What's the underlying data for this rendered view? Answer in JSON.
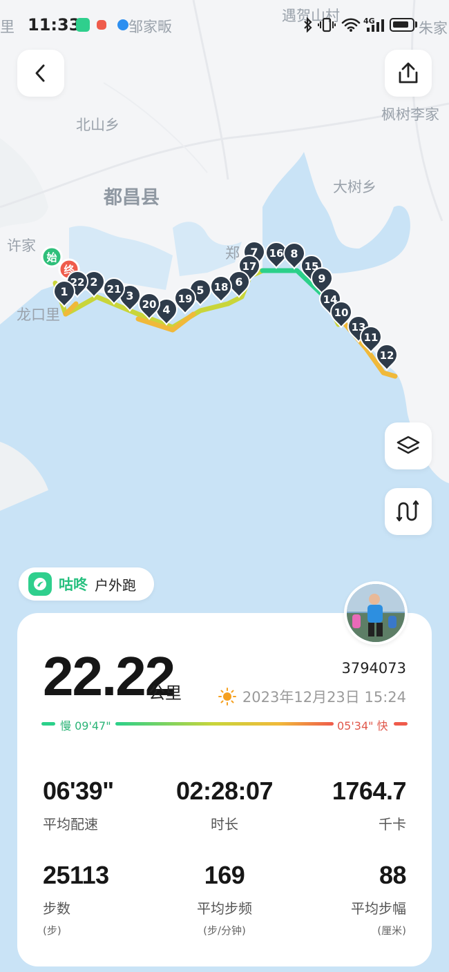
{
  "status_bar": {
    "time": "11:33",
    "network": "4G"
  },
  "map": {
    "labels": {
      "place1": "遇贺山村",
      "place2": "邹家畈",
      "place3": "里",
      "place4": "朱家",
      "place5": "北山乡",
      "place6": "枫树李家",
      "place7": "都昌县",
      "place8": "大树乡",
      "place9": "许家",
      "place10": "龙口里",
      "place11": "郑"
    },
    "start_badge": "始",
    "end_badge": "终",
    "km_markers": [
      "1",
      "2",
      "3",
      "4",
      "5",
      "6",
      "7",
      "8",
      "9",
      "10",
      "11",
      "12",
      "13",
      "14",
      "15",
      "16",
      "17",
      "18",
      "19",
      "20",
      "21",
      "22"
    ],
    "route_colors": {
      "fast": "#2bd08a",
      "mid": "#c9d53a",
      "slow": "#f0b93a"
    }
  },
  "buttons": {
    "back": "back",
    "share": "share",
    "layers": "layers",
    "route": "route"
  },
  "app_chip": {
    "app_name": "咕咚",
    "activity_type": "户外跑"
  },
  "summary": {
    "distance": "22.22",
    "distance_unit": "公里",
    "user_id": "3794073",
    "datetime": "2023年12月23日 15:24",
    "pace_slow_label": "慢 09'47\"",
    "pace_fast_label": "05'34\" 快",
    "colors": {
      "slow": "#2bd08a",
      "fast": "#ef5b4b"
    }
  },
  "stats": [
    {
      "value": "06'39\"",
      "label": "平均配速",
      "sub": ""
    },
    {
      "value": "02:28:07",
      "label": "时长",
      "sub": ""
    },
    {
      "value": "1764.7",
      "label": "千卡",
      "sub": ""
    },
    {
      "value": "25113",
      "label": "步数",
      "sub": "(步)"
    },
    {
      "value": "169",
      "label": "平均步频",
      "sub": "(步/分钟)"
    },
    {
      "value": "88",
      "label": "平均步幅",
      "sub": "(厘米)"
    }
  ]
}
